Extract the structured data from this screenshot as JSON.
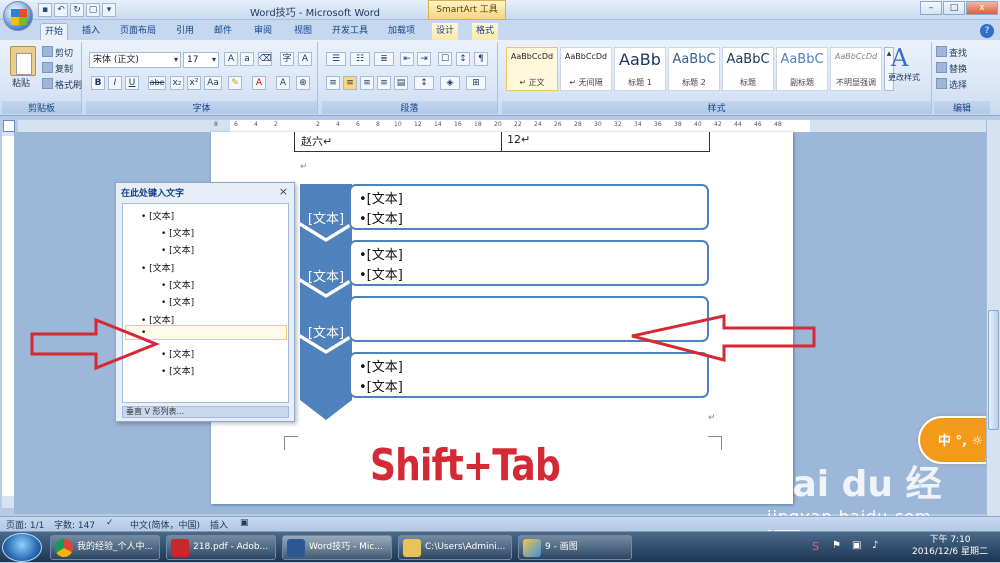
{
  "window": {
    "title": "Word技巧 - Microsoft Word",
    "context_tab_title": "SmartArt 工具",
    "controls": [
      "–",
      "□",
      "x"
    ]
  },
  "tabs": [
    "开始",
    "插入",
    "页面布局",
    "引用",
    "邮件",
    "审阅",
    "视图",
    "开发工具",
    "加载项",
    "设计",
    "格式"
  ],
  "ribbon": {
    "clipboard": {
      "label": "剪贴板",
      "paste": "粘贴",
      "cut": "剪切",
      "copy": "复制",
      "format_painter": "格式刷"
    },
    "font": {
      "label": "字体",
      "font_name": "宋体 (正文)",
      "font_size": "17",
      "buttons": [
        "B",
        "I",
        "U",
        "abe",
        "x₂",
        "x²",
        "Aa"
      ]
    },
    "paragraph": {
      "label": "段落"
    },
    "styles": {
      "label": "样式",
      "items": [
        {
          "sample": "AaBbCcDd",
          "name": "↵ 正文"
        },
        {
          "sample": "AaBbCcDd",
          "name": "↵ 无间隔"
        },
        {
          "sample": "AaBb",
          "name": "标题 1"
        },
        {
          "sample": "AaBbC",
          "name": "标题 2"
        },
        {
          "sample": "AaBbC",
          "name": "标题"
        },
        {
          "sample": "AaBbC",
          "name": "副标题"
        },
        {
          "sample": "AaBbCcDd",
          "name": "不明显强调"
        }
      ],
      "change_styles": "更改样式"
    },
    "editing": {
      "label": "编辑",
      "find": "查找",
      "replace": "替换",
      "select": "选择"
    }
  },
  "ruler": [
    "8",
    "6",
    "4",
    "2",
    "2",
    "4",
    "6",
    "8",
    "10",
    "12",
    "14",
    "16",
    "18",
    "20",
    "22",
    "24",
    "26",
    "28",
    "30",
    "32",
    "34",
    "36",
    "38",
    "40",
    "42",
    "44",
    "46",
    "48"
  ],
  "document": {
    "table_cell_left": "赵六↵",
    "table_cell_right": "12↵",
    "smartart": [
      {
        "label": "[文本]",
        "bullets": [
          "[文本]",
          "[文本]"
        ]
      },
      {
        "label": "[文本]",
        "bullets": [
          "[文本]",
          "[文本]"
        ]
      },
      {
        "label": "[文本]",
        "bullets": []
      },
      {
        "label": "",
        "bullets": [
          "[文本]",
          "[文本]"
        ]
      }
    ]
  },
  "text_pane": {
    "title": "在此处键入文字",
    "close": "×",
    "items": [
      {
        "level": 1,
        "text": "[文本]"
      },
      {
        "level": 2,
        "text": "[文本]"
      },
      {
        "level": 2,
        "text": "[文本]"
      },
      {
        "level": 1,
        "text": "[文本]"
      },
      {
        "level": 2,
        "text": "[文本]"
      },
      {
        "level": 2,
        "text": "[文本]"
      },
      {
        "level": 1,
        "text": "[文本]"
      },
      {
        "level": 1,
        "text": ""
      },
      {
        "level": 2,
        "text": "[文本]"
      },
      {
        "level": 2,
        "text": "[文本]"
      }
    ],
    "footer": "垂直 V 形列表..."
  },
  "annotation": {
    "text": "Shift+Tab",
    "color": "#d42a35"
  },
  "watermark": {
    "brand": "Bai du 经验",
    "url": "jingyan.baidu.com"
  },
  "ime": {
    "text": "中 °, ☼"
  },
  "statusbar": {
    "page": "页面: 1/1",
    "words": "字数: 147",
    "language": "中文(简体，中国)",
    "mode": "插入"
  },
  "taskbar": {
    "items": [
      {
        "label": "我的经验_个人中...",
        "icon": "chrome-icon"
      },
      {
        "label": "218.pdf - Adob...",
        "icon": "pdf-icon"
      },
      {
        "label": "Word技巧 - Mic...",
        "icon": "word-icon"
      },
      {
        "label": "C:\\Users\\Admini...",
        "icon": "folder-icon"
      },
      {
        "label": "9 - 画图",
        "icon": "paint-icon"
      }
    ],
    "time": "下午 7:10",
    "date": "2016/12/6 星期二"
  },
  "colors": {
    "smartart_blue": "#4f81bd",
    "arrow_red": "#d42a35"
  }
}
